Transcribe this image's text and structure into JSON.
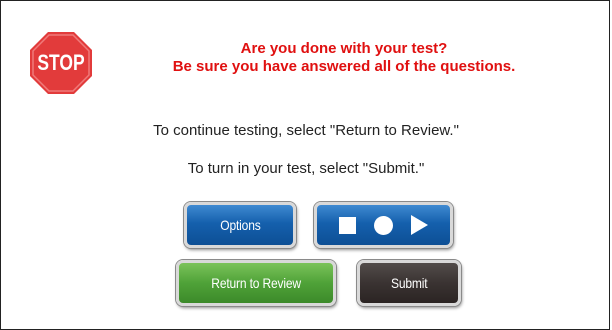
{
  "dialog": {
    "stop_sign": {
      "label": "STOP",
      "color": "#e23b3b"
    },
    "heading": {
      "line1": "Are you done with your test?",
      "line2": "Be sure you have answered all of the questions."
    },
    "instructions": {
      "continue": "To continue testing, select \"Return to Review.\"",
      "turn_in": "To turn in your test, select \"Submit.\""
    },
    "buttons": {
      "options": "Options",
      "return_to_review": "Return to Review",
      "submit": "Submit"
    },
    "media_controls": {
      "icons": [
        "stop-icon",
        "record-icon",
        "play-icon"
      ]
    },
    "colors": {
      "heading": "#e01010",
      "blue_button": "#1560ad",
      "green_button": "#4fa238",
      "dark_button": "#3a3332"
    }
  }
}
